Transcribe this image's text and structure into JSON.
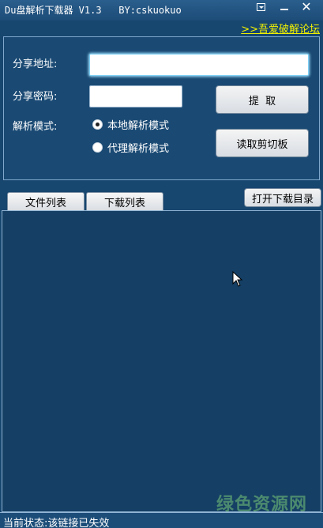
{
  "window": {
    "title": "Du盘解析下载器 V1.3   BY:cskuokuo",
    "forum_link": ">>吾爱破解论坛"
  },
  "form": {
    "share_url_label": "分享地址:",
    "share_url_value": "",
    "share_pwd_label": "分享密码:",
    "share_pwd_value": "",
    "mode_label": "解析模式:",
    "mode_local": "本地解析模式",
    "mode_proxy": "代理解析模式",
    "selected_mode": "本地解析模式"
  },
  "buttons": {
    "extract": "提  取",
    "read_clipboard": "读取剪切板",
    "open_download_dir": "打开下载目录"
  },
  "tabs": [
    {
      "label": "文件列表"
    },
    {
      "label": "下载列表"
    }
  ],
  "status": {
    "text": "当前状态:该链接已失效"
  },
  "watermark": {
    "text": "绿色资源网"
  },
  "icons": {
    "menu": "menu-dropdown-icon",
    "minimize": "minimize-icon",
    "close": "close-icon",
    "cursor": "mouse-pointer-icon"
  }
}
